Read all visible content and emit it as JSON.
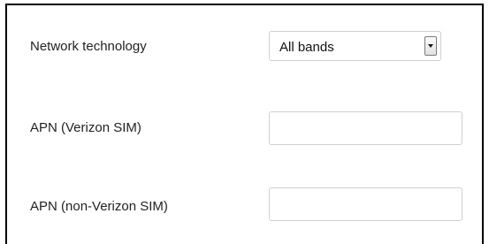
{
  "form": {
    "network_technology": {
      "label": "Network technology",
      "selected_value": "All bands"
    },
    "apn_verizon": {
      "label": "APN (Verizon SIM)",
      "value": ""
    },
    "apn_non_verizon": {
      "label": "APN (non-Verizon SIM)",
      "value": ""
    }
  },
  "colors": {
    "panel_border": "#000000",
    "field_border": "#cfcfcf",
    "label_text": "#222222"
  },
  "icons": {
    "dropdown": "chevron-down-icon"
  }
}
